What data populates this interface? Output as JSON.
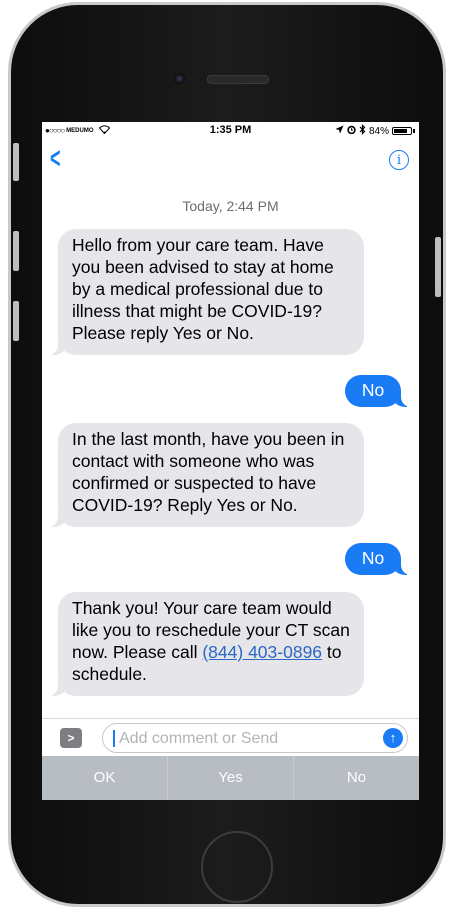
{
  "status_bar": {
    "carrier": "MEDUMO",
    "time": "1:35 PM",
    "battery": "84%",
    "battery_level": 0.84,
    "signal_dots": "●○○○○",
    "icons": [
      "wifi-icon",
      "location-icon",
      "alarm-icon",
      "bluetooth-icon",
      "battery-icon"
    ]
  },
  "nav": {
    "back_icon": "chevron-left-icon",
    "info_icon": "info-icon",
    "info_glyph": "i"
  },
  "conversation": {
    "timestamp": "Today, 2:44 PM",
    "messages": [
      {
        "direction": "incoming",
        "text": "Hello from your care team. Have you been advised to stay at home by a medical professional due to illness that might be COVID-19? Please reply Yes or No."
      },
      {
        "direction": "outgoing",
        "text": "No"
      },
      {
        "direction": "incoming",
        "text": "In the last month, have you been in contact with someone who was confirmed or suspected to have COVID-19? Reply Yes or No."
      },
      {
        "direction": "outgoing",
        "text": "No"
      },
      {
        "direction": "incoming",
        "text_before": "Thank you! Your care team would like you to reschedule your CT scan now. Please call ",
        "link": "(844) 403-0896",
        "text_after": " to schedule."
      }
    ]
  },
  "composer": {
    "placeholder": "Add comment or Send",
    "expand_icon": "chevron-right-icon",
    "send_icon": "arrow-up-icon"
  },
  "quick_replies": [
    "OK",
    "Yes",
    "No"
  ],
  "colors": {
    "accent": "#1a7cf5",
    "incoming_bubble": "#e5e5ea",
    "quick_reply_bar": "#b8bcc3"
  }
}
